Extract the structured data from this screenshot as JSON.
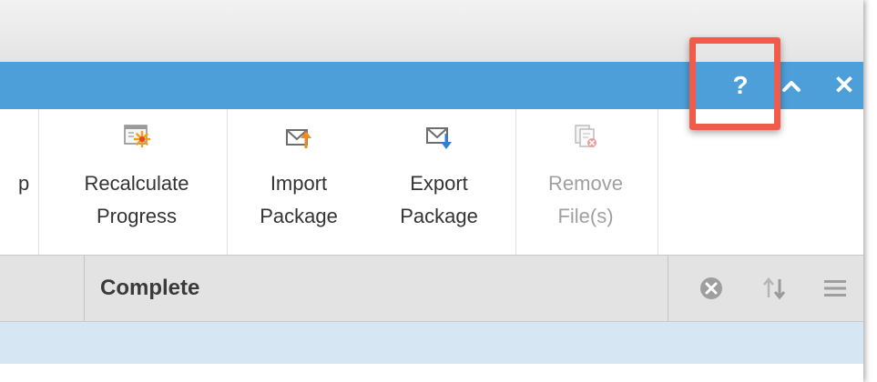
{
  "window": {
    "help_label": "?",
    "close_label": "✕",
    "collapse_icon": "chevron-up-icon"
  },
  "toolbar": {
    "partial_label": "p",
    "buttons": [
      {
        "line1": "Recalculate",
        "line2": "Progress",
        "icon": "recalculate-progress-icon",
        "enabled": true
      },
      {
        "line1": "Import",
        "line2": "Package",
        "icon": "import-package-icon",
        "enabled": true
      },
      {
        "line1": "Export",
        "line2": "Package",
        "icon": "export-package-icon",
        "enabled": true
      },
      {
        "line1": "Remove",
        "line2": "File(s)",
        "icon": "remove-files-icon",
        "enabled": false
      }
    ]
  },
  "column": {
    "title": "Complete",
    "icons": [
      "clear-filter-icon",
      "sort-icon",
      "menu-icon"
    ]
  },
  "colors": {
    "accent_bar": "#4c9fd9",
    "highlight_box": "#f25a4a",
    "selected_row": "#d6e7f3",
    "header_bg": "#e3e3e3"
  }
}
